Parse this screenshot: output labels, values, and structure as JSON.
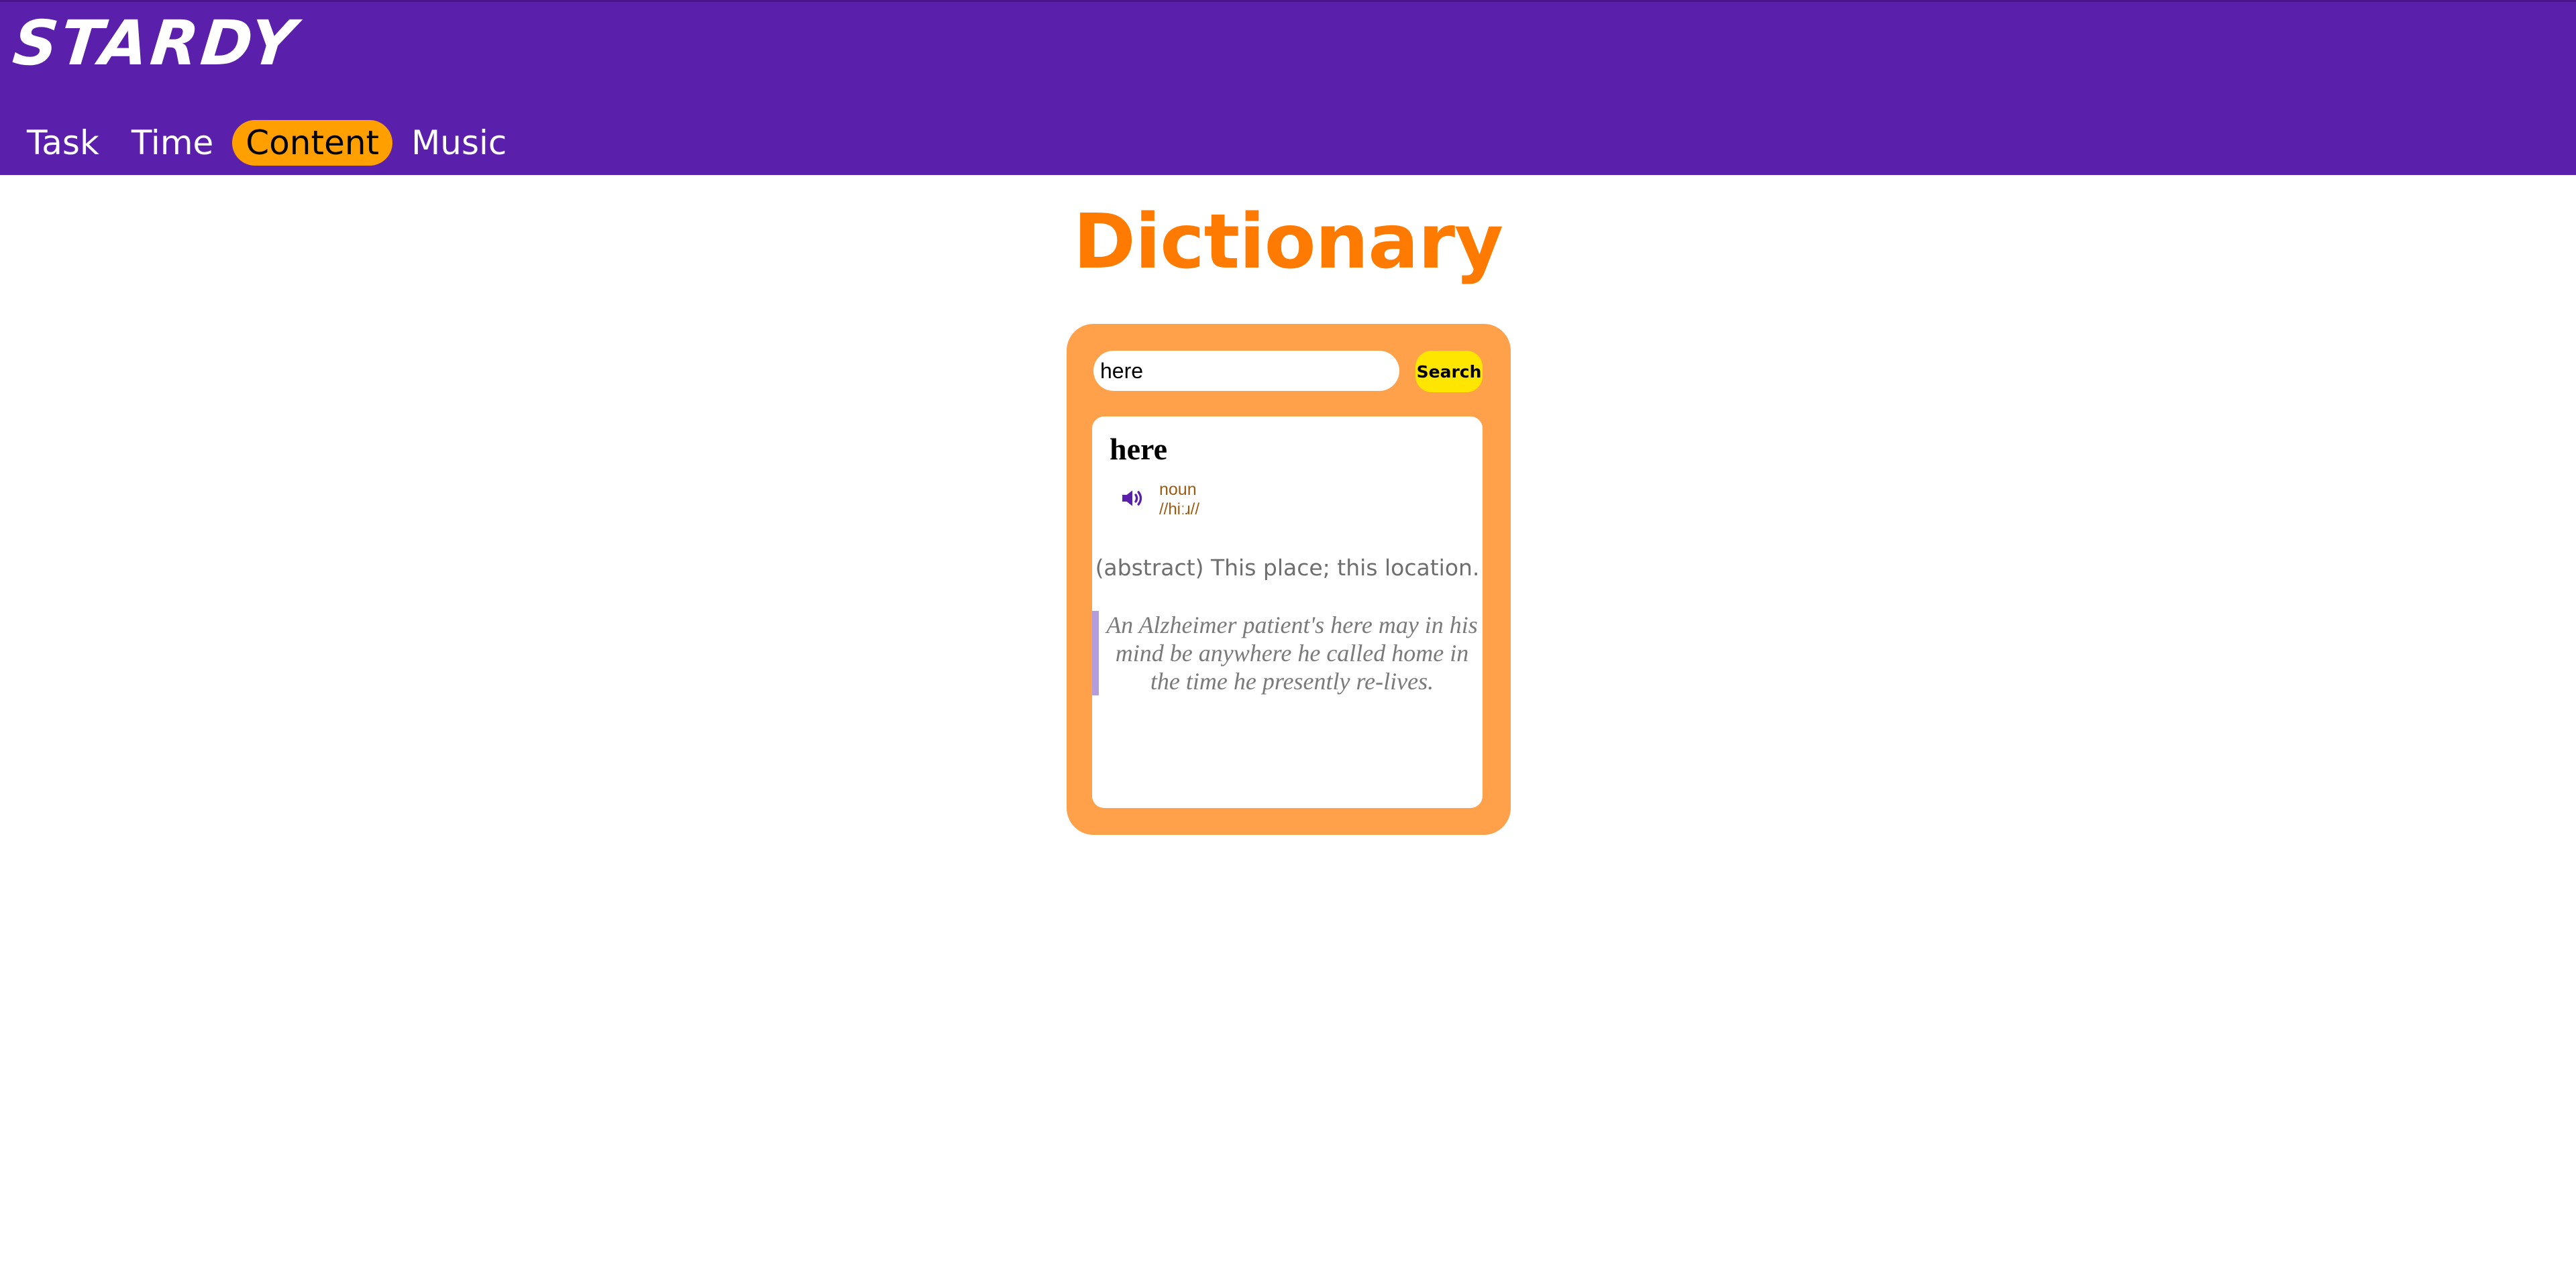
{
  "app": {
    "brand": "STARDY"
  },
  "nav": {
    "items": [
      {
        "label": "Task",
        "active": false
      },
      {
        "label": "Time",
        "active": false
      },
      {
        "label": "Content",
        "active": true
      },
      {
        "label": "Music",
        "active": false
      }
    ]
  },
  "page": {
    "title": "Dictionary"
  },
  "search": {
    "value": "here",
    "button_label": "Search"
  },
  "result": {
    "word": "here",
    "part_of_speech": "noun",
    "phonetic": "//hiːɹ//",
    "definition": "(abstract) This place; this location.",
    "example": "An Alzheimer patient's here may in his mind be anywhere he called home in the time he presently re-lives.",
    "audio_icon": "speaker-icon"
  },
  "colors": {
    "header_bg": "#5a1fab",
    "nav_active_bg": "#ffa000",
    "title": "#ff7a00",
    "panel_bg": "#ffa04a",
    "search_button_bg": "#ffe600",
    "example_accent": "#b39ddb",
    "speaker_icon": "#5a1fab"
  }
}
